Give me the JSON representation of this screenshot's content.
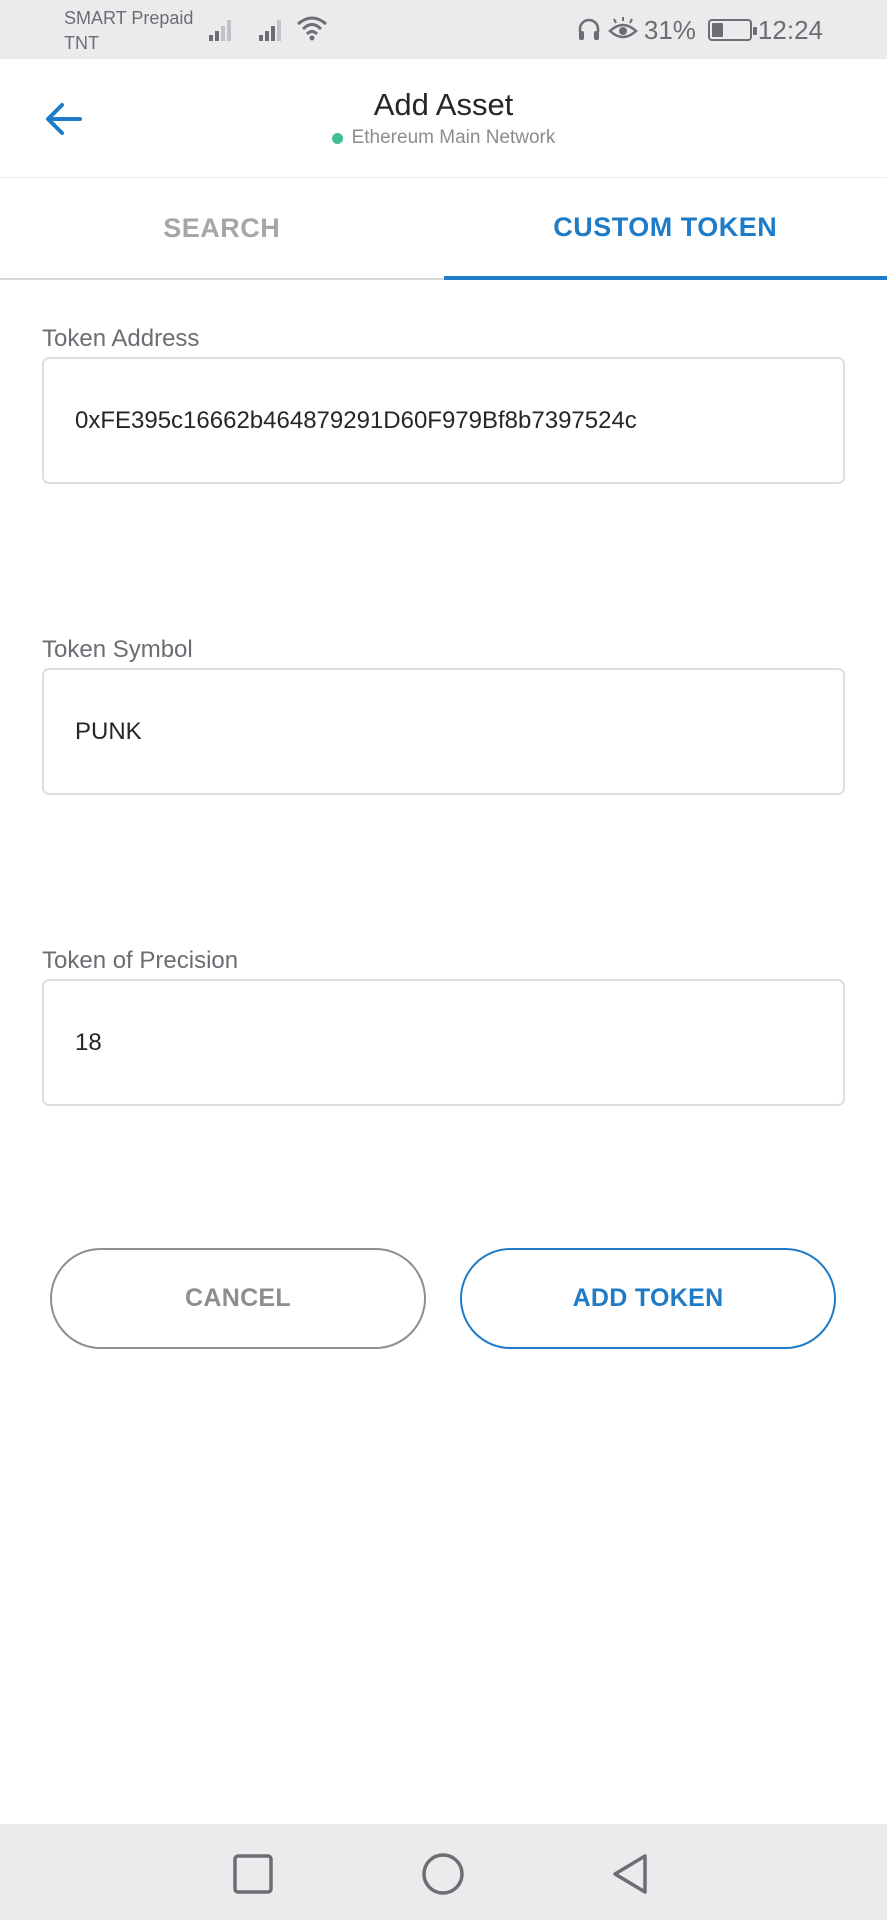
{
  "status_bar": {
    "carrier_1": "SMART Prepaid",
    "carrier_2": "TNT",
    "battery_percent": "31%",
    "battery_level": 0.31,
    "time": "12:24",
    "icons": [
      "signal-icon",
      "signal-icon",
      "wifi-icon",
      "headphones-icon",
      "eye-icon",
      "battery-icon"
    ]
  },
  "header": {
    "title": "Add Asset",
    "network_name": "Ethereum Main Network",
    "network_status_color": "#3fbf99",
    "back_icon": "arrow-left-icon"
  },
  "tabs": [
    {
      "label": "SEARCH",
      "active": false
    },
    {
      "label": "CUSTOM TOKEN",
      "active": true
    }
  ],
  "form": {
    "token_address": {
      "label": "Token Address",
      "value": "0xFE395c16662b464879291D60F979Bf8b7397524c"
    },
    "token_symbol": {
      "label": "Token Symbol",
      "value": "PUNK"
    },
    "token_precision": {
      "label": "Token of Precision",
      "value": "18"
    }
  },
  "buttons": {
    "cancel": "CANCEL",
    "add_token": "ADD TOKEN"
  },
  "nav_bar": {
    "icons": [
      "recent-apps-icon",
      "home-icon",
      "back-icon"
    ]
  },
  "colors": {
    "accent": "#1e7bc7",
    "inactive_text": "#a6a6a6",
    "status_bar_bg": "#ebebed"
  }
}
